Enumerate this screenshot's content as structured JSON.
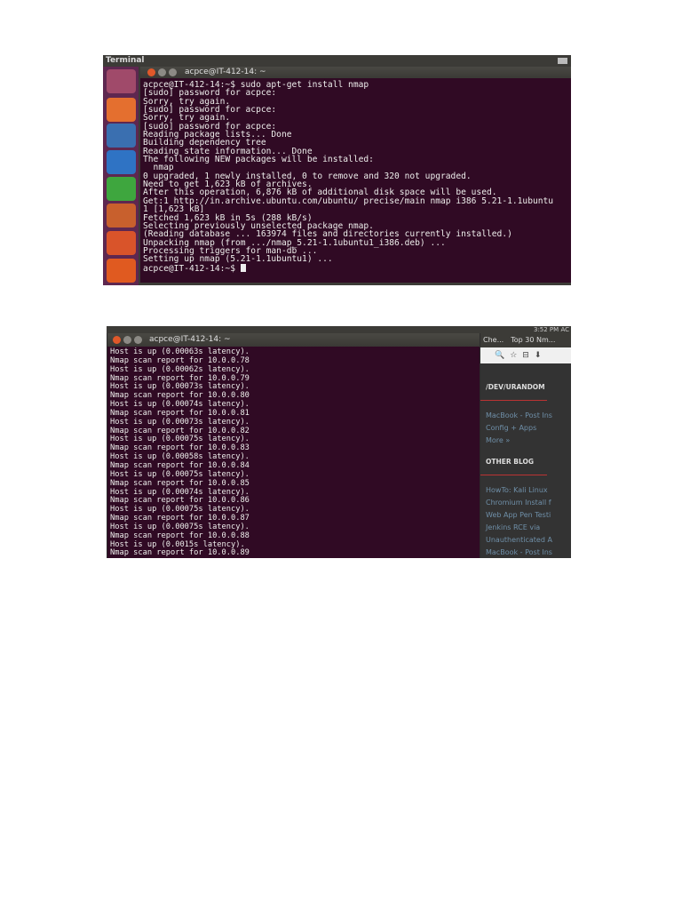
{
  "shot1": {
    "topbar_title": "Terminal",
    "window_title": "acpce@IT-412-14: ~",
    "launcher_icons": [
      "ubuntu-dash-icon",
      "files-icon",
      "firefox-icon",
      "writer-icon",
      "calc-icon",
      "impress-icon",
      "software-center-icon",
      "ubuntu-one-icon"
    ],
    "lines": [
      "acpce@IT-412-14:~$ sudo apt-get install nmap",
      "[sudo] password for acpce:",
      "Sorry, try again.",
      "[sudo] password for acpce:",
      "Sorry, try again.",
      "[sudo] password for acpce:",
      "Reading package lists... Done",
      "Building dependency tree",
      "Reading state information... Done",
      "The following NEW packages will be installed:",
      "  nmap",
      "0 upgraded, 1 newly installed, 0 to remove and 320 not upgraded.",
      "Need to get 1,623 kB of archives.",
      "After this operation, 6,876 kB of additional disk space will be used.",
      "Get:1 http://in.archive.ubuntu.com/ubuntu/ precise/main nmap i386 5.21-1.1ubuntu",
      "1 [1,623 kB]",
      "Fetched 1,623 kB in 5s (288 kB/s)",
      "Selecting previously unselected package nmap.",
      "(Reading database ... 163974 files and directories currently installed.)",
      "Unpacking nmap (from .../nmap_5.21-1.1ubuntu1_i386.deb) ...",
      "Processing triggers for man-db ...",
      "Setting up nmap (5.21-1.1ubuntu1) ..."
    ],
    "prompt": "acpce@IT-412-14:~$ "
  },
  "shot2": {
    "panel_clock": "3:52 PM",
    "panel_user": "AC",
    "window_title": "acpce@IT-412-14: ~",
    "lines": [
      "Host is up (0.00063s latency).",
      "Nmap scan report for 10.0.0.78",
      "Host is up (0.00062s latency).",
      "Nmap scan report for 10.0.0.79",
      "Host is up (0.00073s latency).",
      "Nmap scan report for 10.0.0.80",
      "Host is up (0.00074s latency).",
      "Nmap scan report for 10.0.0.81",
      "Host is up (0.00073s latency).",
      "Nmap scan report for 10.0.0.82",
      "Host is up (0.00075s latency).",
      "Nmap scan report for 10.0.0.83",
      "Host is up (0.00058s latency).",
      "Nmap scan report for 10.0.0.84",
      "Host is up (0.00075s latency).",
      "Nmap scan report for 10.0.0.85",
      "Host is up (0.00074s latency).",
      "Nmap scan report for 10.0.0.86",
      "Host is up (0.00075s latency).",
      "Nmap scan report for 10.0.0.87",
      "Host is up (0.00075s latency).",
      "Nmap scan report for 10.0.0.88",
      "Host is up (0.0015s latency).",
      "Nmap scan report for 10.0.0.89"
    ],
    "browser": {
      "tabs": [
        "Che...",
        "Top 30 Nm..."
      ],
      "toolbar_icons": "🔍☆⊟⬇",
      "section1_title": "/DEV/URANDOM",
      "section1_links": [
        "MacBook - Post Ins",
        "Config + Apps",
        "More »"
      ],
      "section2_title": "OTHER BLOG",
      "section2_links": [
        "HowTo: Kali Linux",
        "Chromium Install f",
        "Web App Pen Testi",
        "Jenkins RCE via",
        "Unauthenticated A",
        "MacBook - Post Ins"
      ]
    }
  }
}
